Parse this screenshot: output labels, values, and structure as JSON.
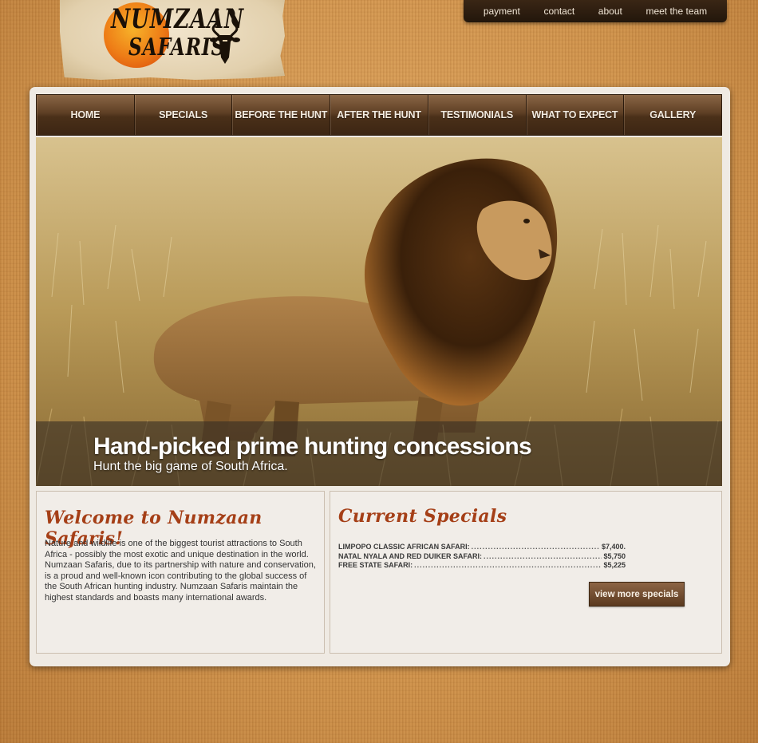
{
  "brand": {
    "line1": "NUMZAAN",
    "line2": "SAFARIS",
    "logo_icon": "kudu-head-icon"
  },
  "top_nav": [
    "payment",
    "contact",
    "about",
    "meet the team"
  ],
  "main_nav": [
    "HOME",
    "SPECIALS",
    "BEFORE THE HUNT",
    "AFTER THE HUNT",
    "TESTIMONIALS",
    "WHAT TO EXPECT",
    "GALLERY"
  ],
  "hero": {
    "title": "Hand-picked prime hunting concessions",
    "subtitle": "Hunt the big game of South Africa."
  },
  "welcome": {
    "heading": "Welcome to Numzaan Safaris!",
    "body": "Nature and wildlife is one of the biggest tourist attractions to South Africa - possibly the most exotic and unique destination in the world. Numzaan Safaris, due to its partnership with nature and conservation, is a proud and well-known icon contributing to the global success of the South African hunting industry. Numzaan Safaris maintain the highest standards and boasts many international awards."
  },
  "specials": {
    "heading": "Current Specials",
    "items": [
      {
        "name": "LIMPOPO CLASSIC AFRICAN SAFARI:",
        "price": "$7,400."
      },
      {
        "name": "NATAL NYALA AND RED DUIKER SAFARI:",
        "price": "$5,750"
      },
      {
        "name": "FREE STATE SAFARI:",
        "price": "$5,225"
      }
    ],
    "button_label": "view more specials"
  },
  "colors": {
    "nav_brown": "#4a3019",
    "heading_rust": "#a53f17",
    "panel_bg": "#f1ede8",
    "page_tan": "#d69a52"
  }
}
